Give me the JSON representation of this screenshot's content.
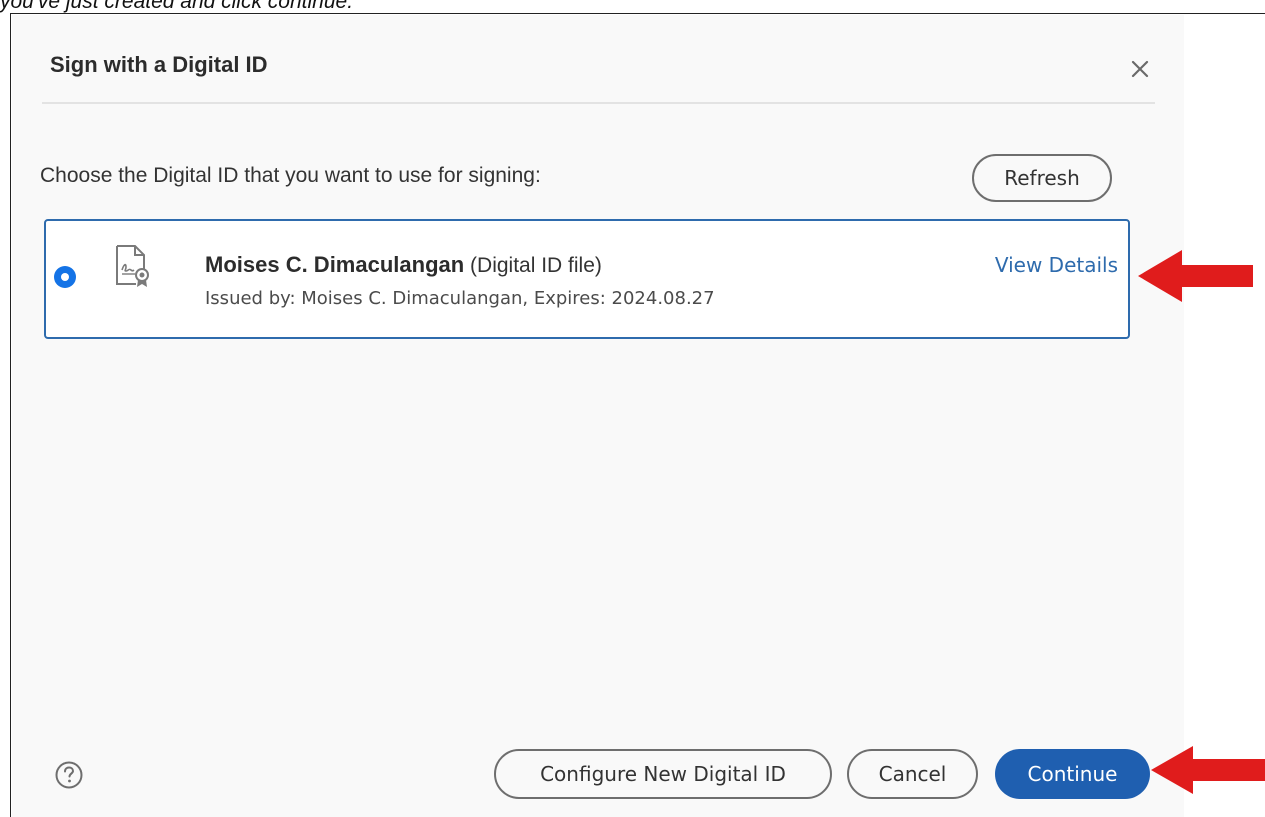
{
  "caption": "you've just created and click continue.",
  "dialog": {
    "title": "Sign with a Digital ID",
    "close_label": "×",
    "choose_label": "Choose the Digital ID that you want to use for signing:",
    "refresh_label": "Refresh",
    "digital_id": {
      "name": "Moises C. Dimaculangan",
      "type": "(Digital ID file)",
      "issued": "Issued by: Moises C. Dimaculangan, Expires: 2024.08.27",
      "view_details_label": "View Details",
      "selected": true
    },
    "footer": {
      "configure_label": "Configure New Digital ID",
      "cancel_label": "Cancel",
      "continue_label": "Continue"
    }
  },
  "colors": {
    "accent": "#1473e6",
    "primary_button": "#1f5fb0",
    "link": "#2e6bad",
    "annotation_arrow": "#e01c1c"
  },
  "icons": [
    "close-icon",
    "certificate-icon",
    "help-icon",
    "red-arrow-icon"
  ]
}
